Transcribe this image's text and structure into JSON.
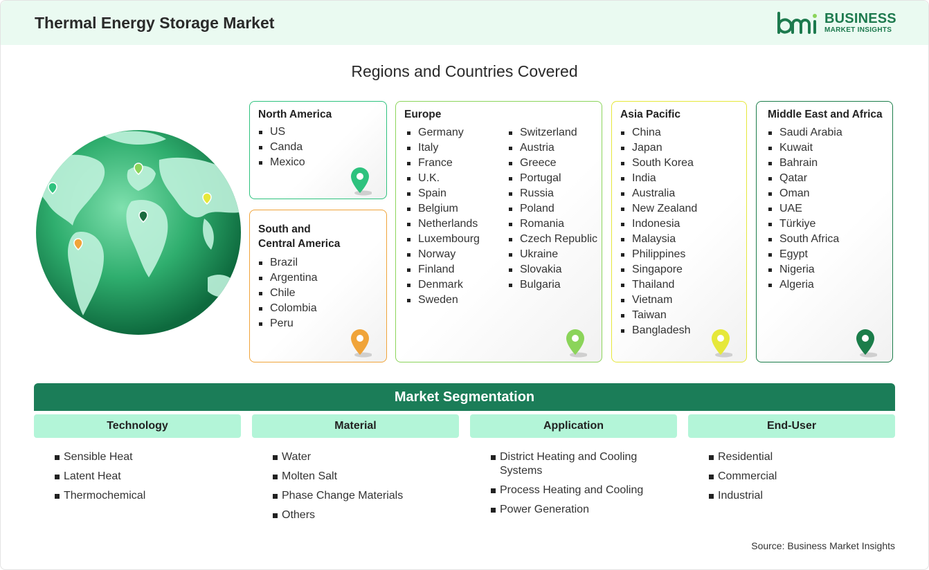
{
  "header": {
    "title": "Thermal Energy Storage Market",
    "logo_line1": "BUSINESS",
    "logo_line2": "MARKET INSIGHTS"
  },
  "regions_title": "Regions and Countries Covered",
  "regions": [
    {
      "name": "North America",
      "color": "#2ec27e",
      "countries": [
        "US",
        "Canda",
        "Mexico"
      ]
    },
    {
      "name_line1": "South and",
      "name_line2": "Central America",
      "color": "#f0a43a",
      "countries": [
        "Brazil",
        "Argentina",
        "Chile",
        "Colombia",
        "Peru"
      ]
    },
    {
      "name": "Europe",
      "color": "#8bd45a",
      "countries_col1": [
        "Germany",
        "Italy",
        "France",
        "U.K.",
        "Spain",
        "Belgium",
        "Netherlands",
        "Luxembourg",
        "Norway",
        "Finland",
        "Denmark",
        "Sweden"
      ],
      "countries_col2": [
        "Switzerland",
        "Austria",
        "Greece",
        "Portugal",
        "Russia",
        "Poland",
        "Romania",
        "Czech Republic",
        "Ukraine",
        "Slovakia",
        "Bulgaria"
      ]
    },
    {
      "name": "Asia Pacific",
      "color": "#e6e83a",
      "countries": [
        "China",
        "Japan",
        "South Korea",
        "India",
        "Australia",
        "New Zealand",
        "Indonesia",
        "Malaysia",
        "Philippines",
        "Singapore",
        "Thailand",
        "Vietnam",
        "Taiwan",
        "Bangladesh"
      ]
    },
    {
      "name": "Middle East and Africa",
      "color": "#1b7d4a",
      "countries": [
        "Saudi Arabia",
        "Kuwait",
        "Bahrain",
        "Qatar",
        "Oman",
        "UAE",
        "Türkiye",
        "South Africa",
        "Egypt",
        "Nigeria",
        "Algeria"
      ]
    }
  ],
  "segmentation": {
    "title": "Market Segmentation",
    "columns": [
      {
        "heading": "Technology",
        "items": [
          "Sensible Heat",
          "Latent Heat",
          "Thermochemical"
        ]
      },
      {
        "heading": "Material",
        "items": [
          "Water",
          "Molten Salt",
          "Phase Change Materials",
          "Others"
        ]
      },
      {
        "heading": "Application",
        "items": [
          "District Heating and Cooling Systems",
          "Process Heating and Cooling",
          "Power Generation"
        ]
      },
      {
        "heading": "End-User",
        "items": [
          "Residential",
          "Commercial",
          "Industrial"
        ]
      }
    ]
  },
  "source": "Source: Business Market Insights",
  "icons": [
    "location-pin-icon",
    "globe-icon",
    "bmi-logo-icon"
  ]
}
